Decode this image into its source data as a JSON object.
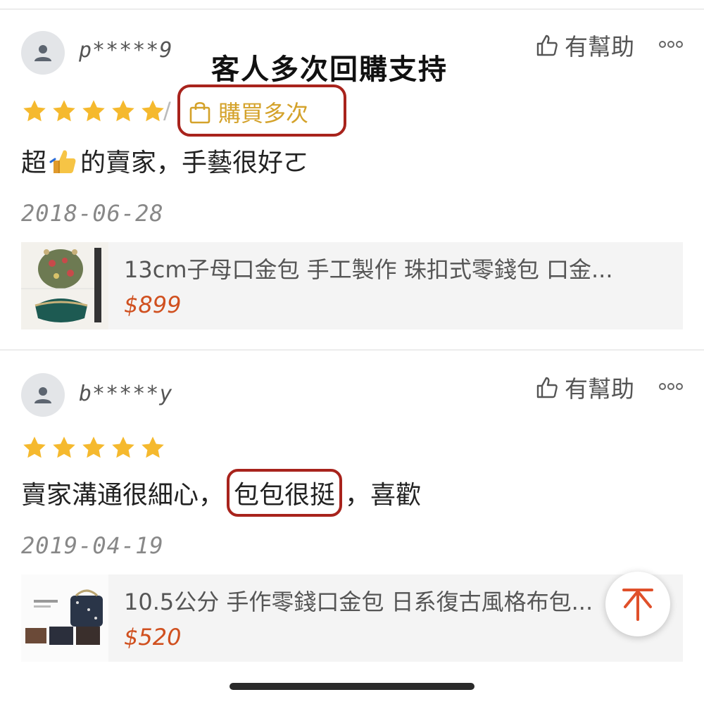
{
  "annotation": "客人多次回購支持",
  "helpful_label": "有幫助",
  "reviews": [
    {
      "username": "p*****9",
      "rating": 5,
      "badge": "購買多次",
      "comment_parts": [
        "超",
        "的賣家，手藝很好ㄛ"
      ],
      "comment_emoji": "thumbs-up-emoji",
      "date": "2018-06-28",
      "product": {
        "title": "13cm子母口金包  手工製作  珠扣式零錢包  口金...",
        "price": "$899"
      }
    },
    {
      "username": "b*****y",
      "rating": 5,
      "comment_before": "賣家溝通很細心，",
      "comment_highlight": "包包很挺",
      "comment_after": "，喜歡",
      "date": "2019-04-19",
      "product": {
        "title": "10.5公分  手作零錢口金包  日系復古風格布包...",
        "price": "$520"
      }
    }
  ],
  "colors": {
    "star": "#f5b92e",
    "highlight_border": "#a8231c",
    "badge_text": "#d4a22a",
    "price": "#d0501f",
    "scroll_top_arrow": "#e0502a"
  },
  "icons": {
    "avatar": "user-icon",
    "helpful": "thumbs-up-outline-icon",
    "more": "more-dots-icon",
    "badge": "shopping-bag-icon",
    "scroll_top": "arrow-up-icon"
  }
}
